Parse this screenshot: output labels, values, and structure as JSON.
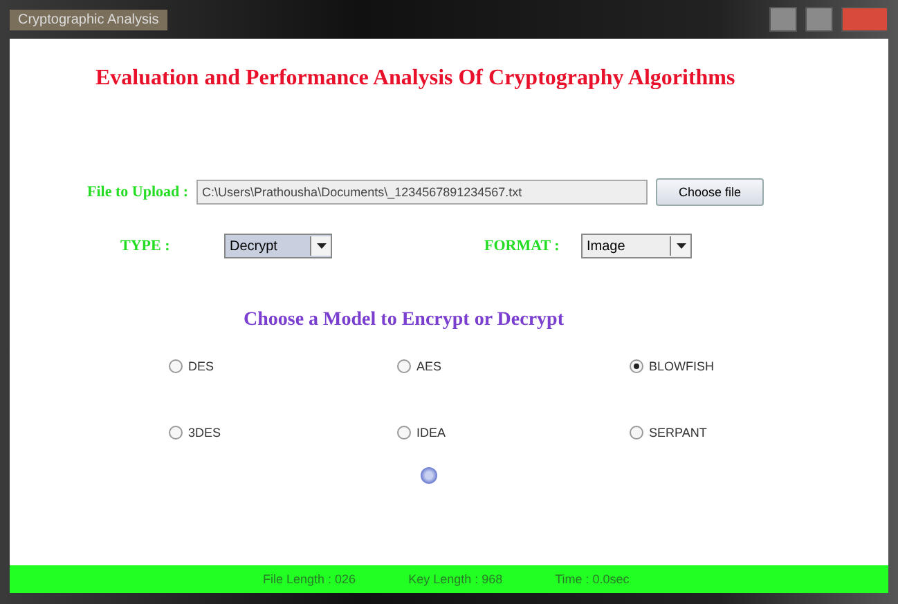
{
  "window": {
    "title": "Cryptographic Analysis"
  },
  "heading": "Evaluation and Performance Analysis Of Cryptography Algorithms",
  "upload": {
    "label": "File to Upload :",
    "value": "C:\\Users\\Prathousha\\Documents\\_1234567891234567.txt",
    "button": "Choose file"
  },
  "type": {
    "label": "TYPE :",
    "value": "Decrypt"
  },
  "format": {
    "label": "FORMAT :",
    "value": "Image"
  },
  "model_heading": "Choose a Model to Encrypt or Decrypt",
  "models": [
    {
      "label": "DES",
      "selected": false
    },
    {
      "label": "AES",
      "selected": false
    },
    {
      "label": "BLOWFISH",
      "selected": true
    },
    {
      "label": "3DES",
      "selected": false
    },
    {
      "label": "IDEA",
      "selected": false
    },
    {
      "label": "SERPANT",
      "selected": false
    }
  ],
  "status_bar": [
    "File Length : 026",
    "Key Length : 968",
    "Time : 0.0sec"
  ]
}
